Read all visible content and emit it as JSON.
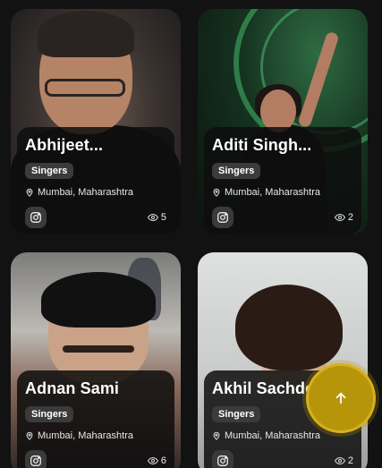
{
  "cards": [
    {
      "name": "Abhijeet...",
      "category": "Singers",
      "location": "Mumbai, Maharashtra",
      "views": "5"
    },
    {
      "name": "Aditi Singh...",
      "category": "Singers",
      "location": "Mumbai, Maharashtra",
      "views": "2"
    },
    {
      "name": "Adnan Sami",
      "category": "Singers",
      "location": "Mumbai, Maharashtra",
      "views": "6"
    },
    {
      "name": "Akhil Sachdeva",
      "category": "Singers",
      "location": "Mumbai, Maharashtra",
      "views": "2"
    }
  ],
  "icons": {
    "location": "map-pin-icon",
    "social": "instagram-icon",
    "views": "eye-icon",
    "scroll": "arrow-up-icon"
  },
  "colors": {
    "accent": "#b7950b",
    "background": "#121212",
    "badge": "#3b3b3b"
  }
}
